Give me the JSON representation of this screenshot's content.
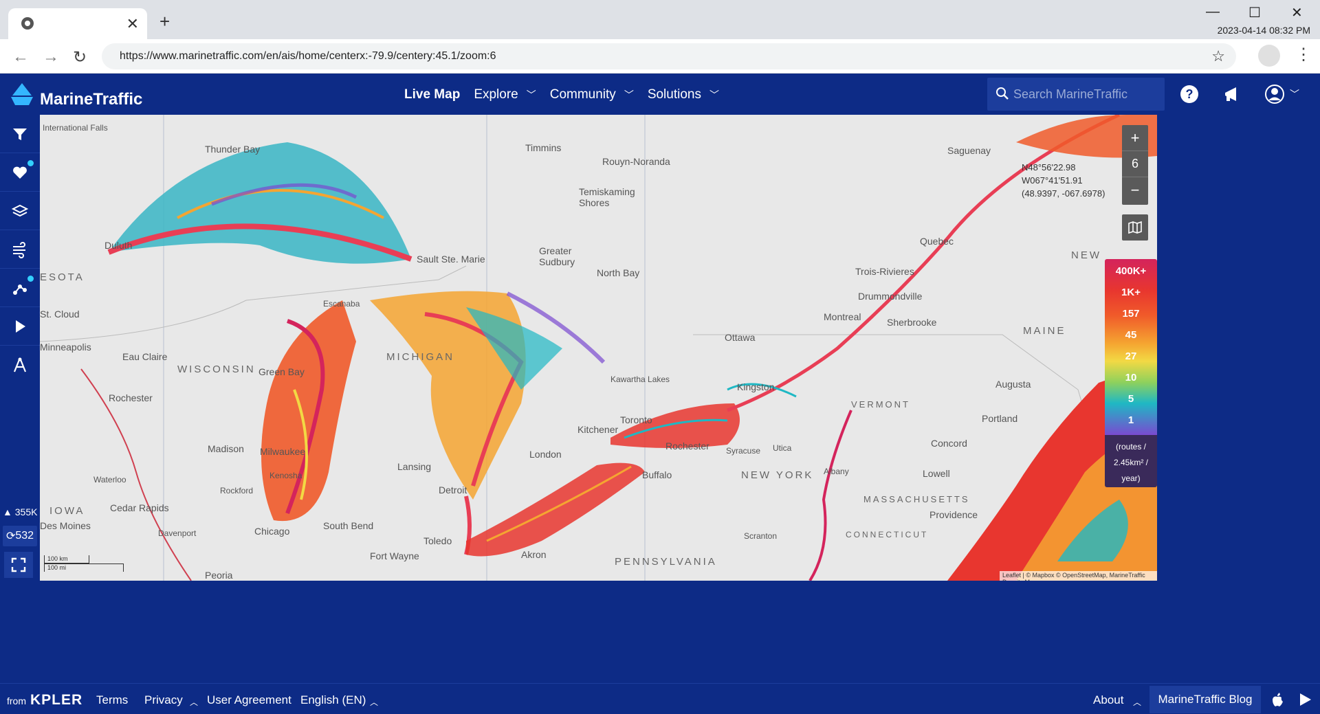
{
  "browser": {
    "tab_close": "✕",
    "new_tab": "+",
    "url": "https://www.marinetraffic.com/en/ais/home/centerx:-79.9/centery:45.1/zoom:6",
    "datetime": "2023-04-14 08:32 PM"
  },
  "header": {
    "logo_text": "MarineTraffic",
    "nav": [
      {
        "label": "Live Map"
      },
      {
        "label": "Explore"
      },
      {
        "label": "Community"
      },
      {
        "label": "Solutions"
      }
    ],
    "search_placeholder": "Search MarineTraffic"
  },
  "sidebar": {
    "vessel_count": "355K",
    "port_count": "532"
  },
  "map": {
    "zoom_level": "6",
    "zoom_in": "+",
    "zoom_out": "−",
    "coords": [
      "N48°56'22.98",
      "W067°41'51.91",
      "(48.9397, -067.6978)"
    ],
    "legend": [
      "400K+",
      "1K+",
      "157",
      "45",
      "27",
      "10",
      "5",
      "1"
    ],
    "legend_unit": [
      "(routes /",
      "2.45km² /",
      "year)"
    ],
    "scale": [
      "100 km",
      "100 mi"
    ],
    "attribution": "Leaflet | © Mapbox © OpenStreetMap, MarineTraffic Density Maps",
    "places": [
      {
        "name": "International Falls"
      },
      {
        "name": "Thunder Bay"
      },
      {
        "name": "Timmins"
      },
      {
        "name": "Rouyn-Noranda"
      },
      {
        "name": "Saguenay"
      },
      {
        "name": "Temiskaming Shores"
      },
      {
        "name": "Duluth"
      },
      {
        "name": "Sault Ste. Marie"
      },
      {
        "name": "Greater Sudbury"
      },
      {
        "name": "North Bay"
      },
      {
        "name": "Quebec"
      },
      {
        "name": "Trois-Rivieres"
      },
      {
        "name": "Drummondville"
      },
      {
        "name": "Sherbrooke"
      },
      {
        "name": "Montreal"
      },
      {
        "name": "Ottawa"
      },
      {
        "name": "Escanaba"
      },
      {
        "name": "St. Cloud"
      },
      {
        "name": "Minneapolis"
      },
      {
        "name": "Eau Claire"
      },
      {
        "name": "Green Bay"
      },
      {
        "name": "Kingston"
      },
      {
        "name": "Kawartha Lakes"
      },
      {
        "name": "Augusta"
      },
      {
        "name": "Portland"
      },
      {
        "name": "Rochester"
      },
      {
        "name": "Kitchener"
      },
      {
        "name": "London"
      },
      {
        "name": "Toronto"
      },
      {
        "name": "Rochester"
      },
      {
        "name": "Syracuse"
      },
      {
        "name": "Utica"
      },
      {
        "name": "Concord"
      },
      {
        "name": "Lowell"
      },
      {
        "name": "Madison"
      },
      {
        "name": "Milwaukee"
      },
      {
        "name": "Lansing"
      },
      {
        "name": "Buffalo"
      },
      {
        "name": "Albany"
      },
      {
        "name": "Waterloo"
      },
      {
        "name": "Rockford"
      },
      {
        "name": "Kenosha"
      },
      {
        "name": "Detroit"
      },
      {
        "name": "Providence"
      },
      {
        "name": "Cedar Rapids"
      },
      {
        "name": "Des Moines"
      },
      {
        "name": "Davenport"
      },
      {
        "name": "Chicago"
      },
      {
        "name": "South Bend"
      },
      {
        "name": "Toledo"
      },
      {
        "name": "Fort Wayne"
      },
      {
        "name": "Akron"
      },
      {
        "name": "Scranton"
      },
      {
        "name": "Peoria"
      }
    ],
    "regions": [
      {
        "name": "ESOTA"
      },
      {
        "name": "WISCONSIN"
      },
      {
        "name": "MICHIGAN"
      },
      {
        "name": "IOWA"
      },
      {
        "name": "NEW YORK"
      },
      {
        "name": "PENNSYLVANIA"
      },
      {
        "name": "VERMONT"
      },
      {
        "name": "MASSACHUSETTS"
      },
      {
        "name": "CONNECTICUT"
      },
      {
        "name": "MAINE"
      },
      {
        "name": "NEW"
      }
    ]
  },
  "footer": {
    "from": "from",
    "brand": "KPLER",
    "links": [
      "Terms",
      "Privacy",
      "User Agreement",
      "English (EN)"
    ],
    "about": "About",
    "blog": "MarineTraffic Blog"
  }
}
